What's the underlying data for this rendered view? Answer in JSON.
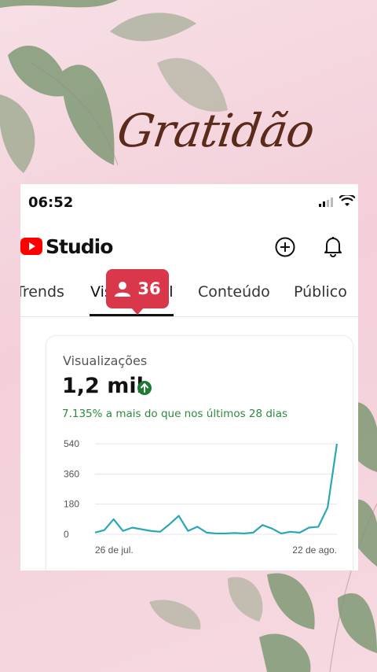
{
  "overlay": {
    "title": "Gratidão"
  },
  "status_bar": {
    "time": "06:52"
  },
  "header": {
    "brand": "Studio",
    "icons": [
      "add-icon",
      "bell-icon"
    ]
  },
  "tabs": [
    {
      "label": "Trends"
    },
    {
      "label": "Visão geral"
    },
    {
      "label": "Conteúdo"
    },
    {
      "label": "Público"
    }
  ],
  "badge": {
    "count": "36",
    "icon": "person-icon"
  },
  "card": {
    "title": "Visualizações",
    "value": "1,2 mil",
    "delta": "7.135% a mais do que nos últimos 28 dias"
  },
  "colors": {
    "accent_red": "#d9384a",
    "line": "#2aa7b7",
    "positive": "#2e8b3c"
  },
  "chart_data": {
    "type": "line",
    "y_ticks": [
      0,
      180,
      360,
      540
    ],
    "ylim": [
      0,
      540
    ],
    "x_start_label": "26 de jul.",
    "x_end_label": "22 de ago.",
    "series": [
      {
        "values": [
          10,
          25,
          90,
          20,
          40,
          30,
          20,
          15,
          60,
          110,
          20,
          45,
          10,
          5,
          5,
          8,
          5,
          10,
          55,
          35,
          5,
          15,
          10,
          40,
          45,
          160,
          540
        ]
      }
    ]
  }
}
